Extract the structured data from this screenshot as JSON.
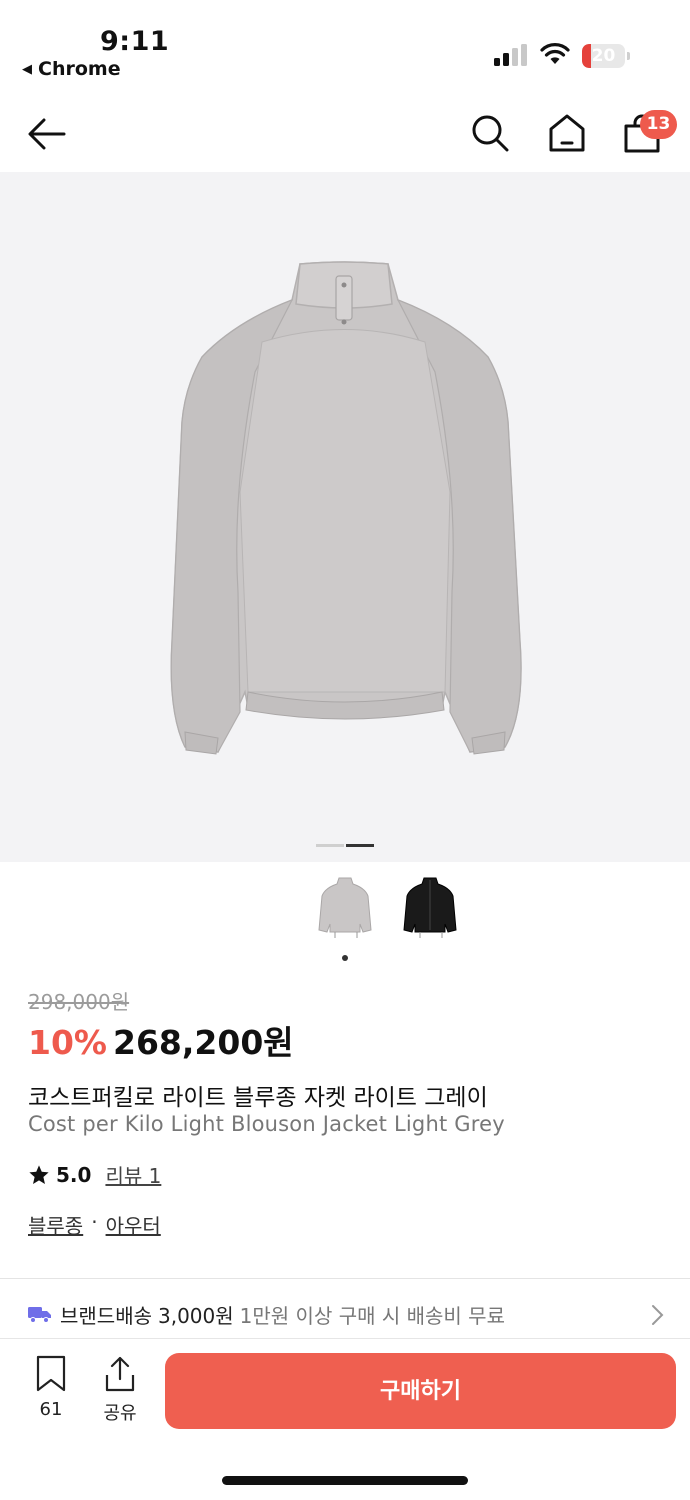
{
  "status_bar": {
    "time": "9:11",
    "back_app": "Chrome",
    "battery": "20",
    "battery_level": 0.2,
    "battery_color": "#e5413b"
  },
  "nav": {
    "cart_count": "13",
    "icons": [
      "back-arrow-icon",
      "search-icon",
      "home-icon",
      "shopping-bag-icon"
    ]
  },
  "gallery": {
    "page_count": 2,
    "active_page": 2,
    "color_options": [
      "light-grey",
      "black"
    ],
    "selected_color": 1
  },
  "product": {
    "original_price": "298,000원",
    "discount": "10%",
    "price": "268,200원",
    "title_ko": "코스트퍼킬로 라이트 블루종 자켓 라이트 그레이",
    "title_en": "Cost per Kilo Light Blouson Jacket Light Grey",
    "rating": "5.0",
    "reviews": "리뷰 1",
    "categories": [
      "블루종",
      "아우터"
    ],
    "category_sep": "·"
  },
  "delivery": {
    "label": "브랜드배송",
    "cost": "3,000원",
    "note": "1만원 이상 구매 시 배송비 무료"
  },
  "bottom_bar": {
    "wish_count": "61",
    "share_label": "공유",
    "buy_label": "구매하기"
  },
  "colors": {
    "accent": "#ee5a4d",
    "buy_button": "#ef5f50",
    "delivery_icon": "#6f6ee8"
  }
}
